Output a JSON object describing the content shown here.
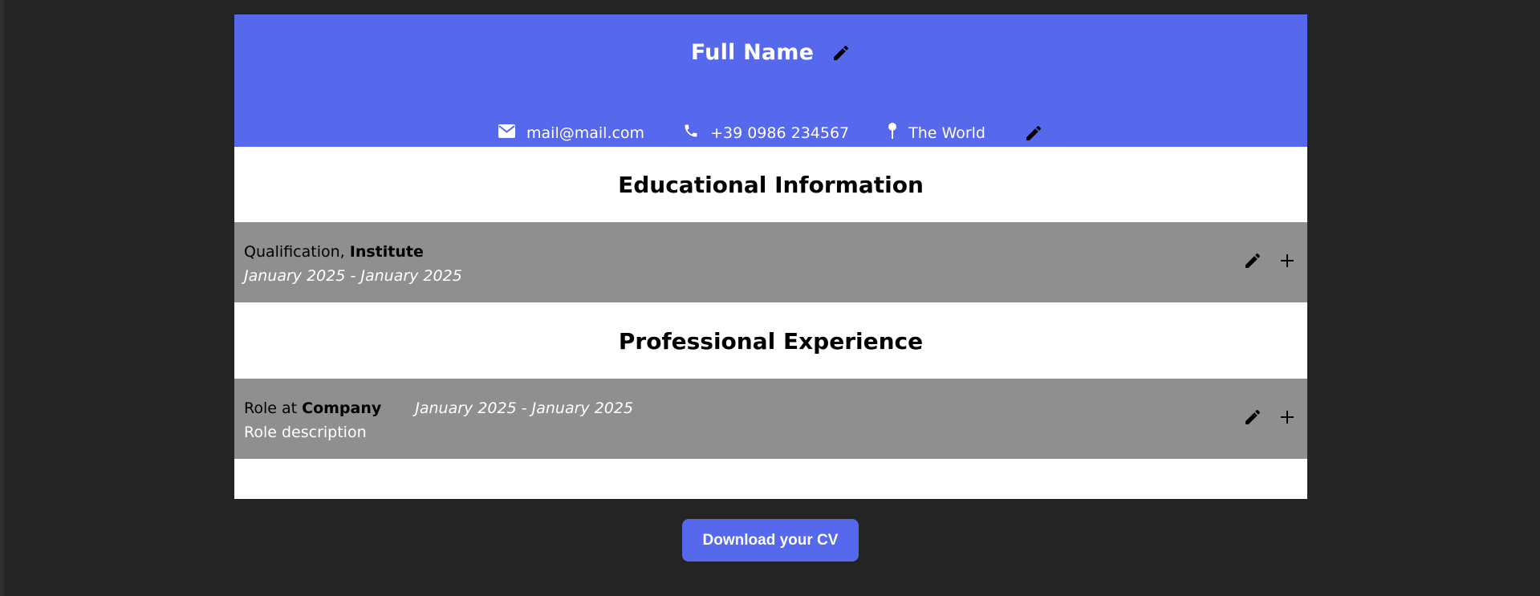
{
  "header": {
    "full_name": "Full Name",
    "email": "mail@mail.com",
    "phone": "+39 0986 234567",
    "location": "The World"
  },
  "icons": {
    "edit": "pencil-icon",
    "add": "plus-icon",
    "email": "envelope-icon",
    "phone": "phone-icon",
    "location": "pin-icon"
  },
  "education": {
    "title": "Educational Information",
    "entries": [
      {
        "qualification": "Qualification,",
        "institute": "Institute",
        "dates": "January 2025 - January 2025"
      }
    ]
  },
  "experience": {
    "title": "Professional Experience",
    "entries": [
      {
        "role": "Role at",
        "company": "Company",
        "dates": "January 2025 - January 2025",
        "description": "Role description"
      }
    ]
  },
  "actions": {
    "download_label": "Download your CV"
  },
  "colors": {
    "accent": "#5668eb",
    "page_background": "#242424",
    "entry_background": "#8f8f8f"
  }
}
